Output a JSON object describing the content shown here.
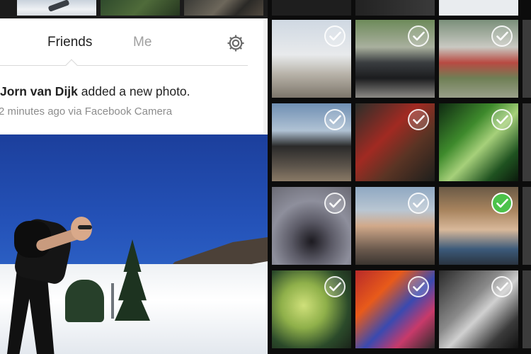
{
  "feed": {
    "tabs": [
      {
        "label": "Friends",
        "active": true
      },
      {
        "label": "Me",
        "active": false
      }
    ],
    "settings_icon": "gear-icon",
    "story": {
      "author": "Jorn van Dijk",
      "action": "added a new photo.",
      "meta": "2 minutes ago via Facebook Camera"
    }
  },
  "grid": {
    "tiles": [
      {
        "subject": "yellow-sculpture",
        "selected": false
      },
      {
        "subject": "vintage-car",
        "selected": false
      },
      {
        "subject": "red-building",
        "selected": false
      },
      {
        "subject": "man-on-table",
        "selected": false
      },
      {
        "subject": "man-red-shirt",
        "selected": false
      },
      {
        "subject": "green-leaf",
        "selected": false
      },
      {
        "subject": "puddle",
        "selected": false
      },
      {
        "subject": "man-sunglasses",
        "selected": false
      },
      {
        "subject": "smiling-man",
        "selected": true
      },
      {
        "subject": "graffiti-wall",
        "selected": false
      },
      {
        "subject": "party-crowd",
        "selected": false
      },
      {
        "subject": "group-bw",
        "selected": false
      }
    ]
  },
  "colors": {
    "selected_check": "#4cc24a",
    "tab_active": "#222222",
    "tab_inactive": "#a0a0a0"
  }
}
